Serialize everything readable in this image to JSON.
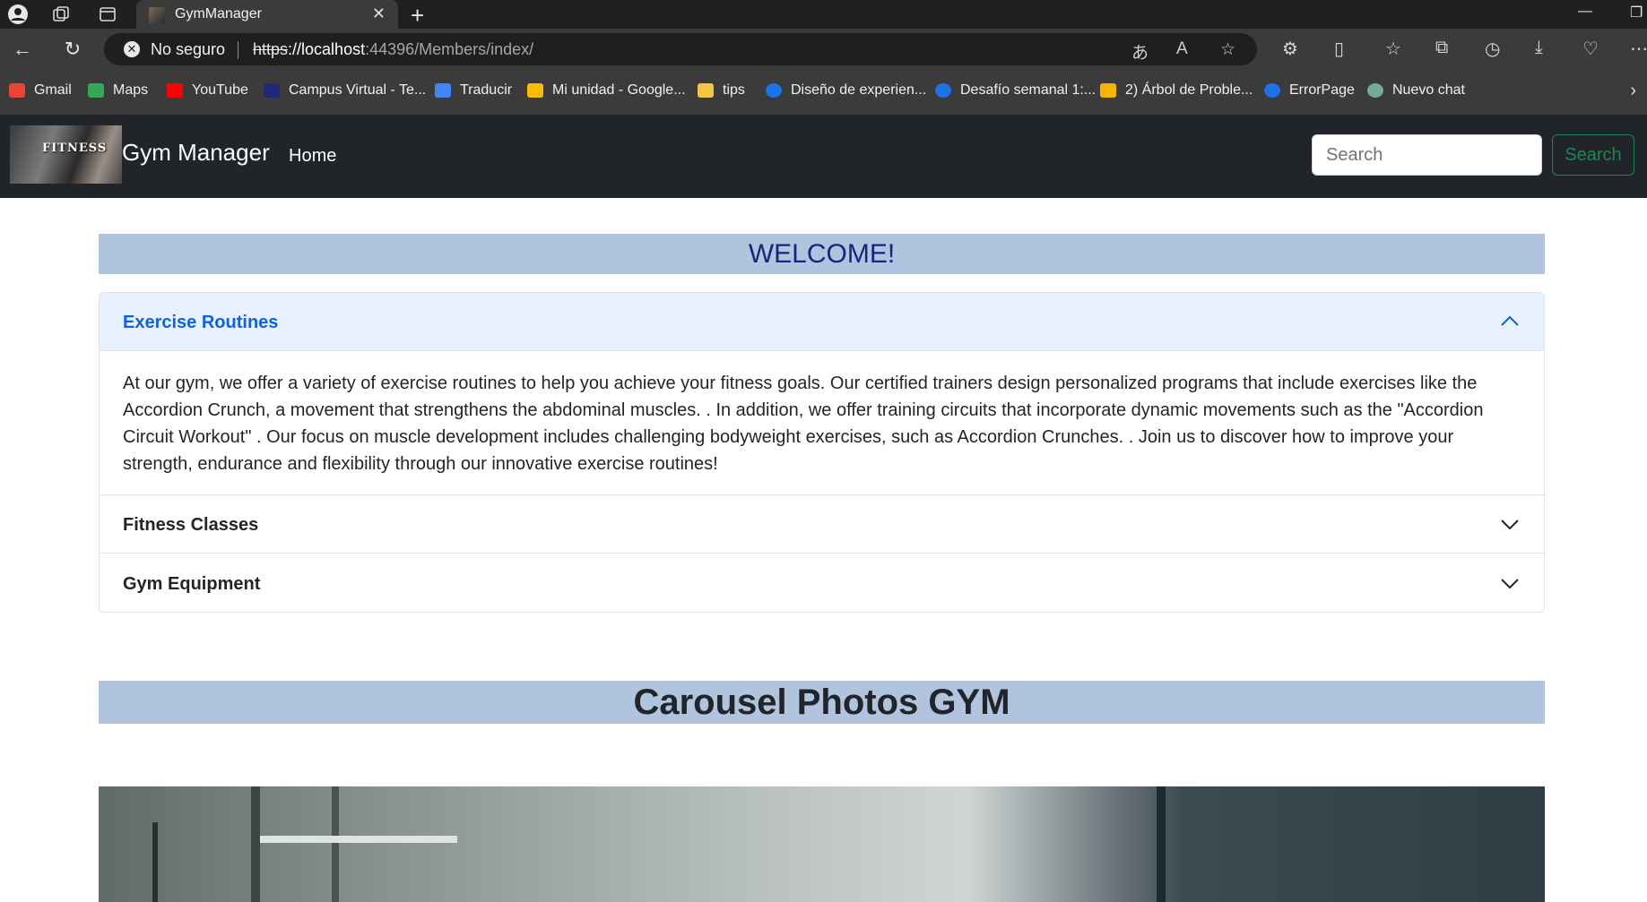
{
  "browser": {
    "tab_title": "GymManager",
    "omnibox": {
      "security_label": "No seguro",
      "url_scheme": "https",
      "url_host": "://localhost",
      "url_path": ":44396/Members/index/"
    },
    "bookmarks": [
      {
        "label": "Gmail",
        "color": "#ea4335"
      },
      {
        "label": "Maps",
        "color": "#34a853"
      },
      {
        "label": "YouTube",
        "color": "#ff0000"
      },
      {
        "label": "Campus Virtual - Te...",
        "color": "#1e2a78"
      },
      {
        "label": "Traducir",
        "color": "#4285f4"
      },
      {
        "label": "Mi unidad - Google...",
        "color": "#fbbc04"
      },
      {
        "label": "tips",
        "color": "#f4c542"
      },
      {
        "label": "Diseño de experien...",
        "color": "#1a73e8"
      },
      {
        "label": "Desafío semanal 1:...",
        "color": "#1a73e8"
      },
      {
        "label": "2) Árbol de Proble...",
        "color": "#f4b400"
      },
      {
        "label": "ErrorPage",
        "color": "#1a73e8"
      },
      {
        "label": "Nuevo chat",
        "color": "#74aa9c"
      }
    ]
  },
  "site": {
    "brand": "Gym Manager",
    "logo_text": "FITNESS",
    "nav_home": "Home",
    "search_placeholder": "Search",
    "search_button": "Search"
  },
  "main": {
    "welcome": "WELCOME!",
    "accordion": [
      {
        "title": "Exercise Routines",
        "expanded": true,
        "body": "At our gym, we offer a variety of exercise routines to help you achieve your fitness goals. Our certified trainers design personalized programs that include exercises like the Accordion Crunch, a movement that strengthens the abdominal muscles. . In addition, we offer training circuits that incorporate dynamic movements such as the \"Accordion Circuit Workout\" . Our focus on muscle development includes challenging bodyweight exercises, such as Accordion Crunches. . Join us to discover how to improve your strength, endurance and flexibility through our innovative exercise routines!"
      },
      {
        "title": "Fitness Classes",
        "expanded": false
      },
      {
        "title": "Gym Equipment",
        "expanded": false
      }
    ],
    "carousel_title": "Carousel Photos GYM"
  },
  "colors": {
    "navbar_bg": "#212529",
    "section_header_bg": "#b0c4de",
    "accordion_active_bg": "#e7f1ff",
    "accordion_active_text": "#0c63e4",
    "search_button": "#198754"
  }
}
